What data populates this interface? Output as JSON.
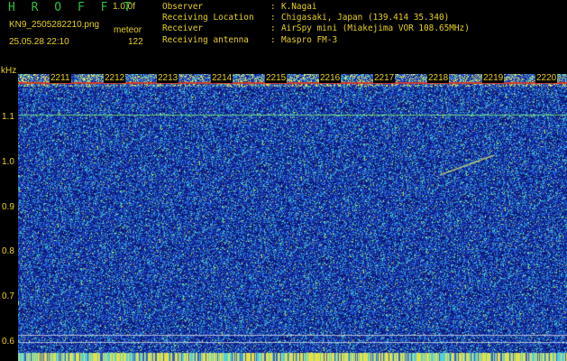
{
  "header": {
    "brand": "H R O F F T",
    "version": "1.0.0f",
    "filename": "KN9_2505282210.png",
    "mode_label": "meteor",
    "timestamp": "25.05.28 22:10",
    "count": "122"
  },
  "station": {
    "rows": [
      {
        "key": "Observer",
        "value": "K.Nagai"
      },
      {
        "key": "Receiving Location",
        "value": "Chigasaki, Japan (139.414 35.340)"
      },
      {
        "key": "Receiver",
        "value": "AirSpy mini (Miakejima VOR 108.65MHz)"
      },
      {
        "key": "Receiving antenna",
        "value": "Maspro FM-3"
      }
    ]
  },
  "axis": {
    "unit_label": "kHz",
    "freq_ticks": [
      "1.1",
      "1.0",
      "0.9",
      "0.8",
      "0.7",
      "0.6"
    ],
    "time_ticks": [
      "2211",
      "2212",
      "2213",
      "2214",
      "2215",
      "2216",
      "2217",
      "2218",
      "2219",
      "2220"
    ]
  },
  "colors": {
    "background": "#000000",
    "text": "#e8d020",
    "brand": "#2fbf3f",
    "waterfall_base": "#1a2a9a"
  }
}
